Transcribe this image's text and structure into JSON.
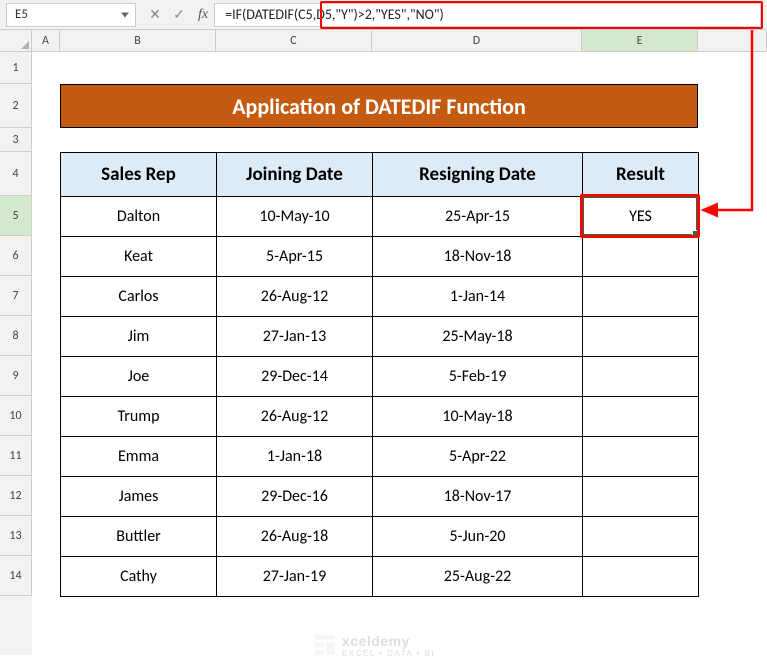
{
  "name_box": "E5",
  "formula": "=IF(DATEDIF(C5,D5,\"Y\")>2,\"YES\",\"NO\")",
  "col_headers": [
    "A",
    "B",
    "C",
    "D",
    "E"
  ],
  "row_headers": [
    "1",
    "2",
    "3",
    "4",
    "5",
    "6",
    "7",
    "8",
    "9",
    "10",
    "11",
    "12",
    "13",
    "14"
  ],
  "title": "Application of DATEDIF Function",
  "table": {
    "headers": [
      "Sales Rep",
      "Joining Date",
      "Resigning Date",
      "Result"
    ],
    "rows": [
      {
        "rep": "Dalton",
        "join": "10-May-10",
        "resign": "25-Apr-15",
        "result": "YES"
      },
      {
        "rep": "Keat",
        "join": "5-Apr-15",
        "resign": "18-Nov-18",
        "result": ""
      },
      {
        "rep": "Carlos",
        "join": "26-Aug-12",
        "resign": "1-Jan-14",
        "result": ""
      },
      {
        "rep": "Jim",
        "join": "27-Jan-13",
        "resign": "25-May-18",
        "result": ""
      },
      {
        "rep": "Joe",
        "join": "29-Dec-14",
        "resign": "5-Feb-19",
        "result": ""
      },
      {
        "rep": "Trump",
        "join": "26-Aug-12",
        "resign": "10-May-18",
        "result": ""
      },
      {
        "rep": "Emma",
        "join": "1-Jan-18",
        "resign": "5-Apr-22",
        "result": ""
      },
      {
        "rep": "James",
        "join": "29-Dec-16",
        "resign": "18-Nov-17",
        "result": ""
      },
      {
        "rep": "Buttler",
        "join": "26-Aug-18",
        "resign": "5-Jun-20",
        "result": ""
      },
      {
        "rep": "Cathy",
        "join": "27-Jan-19",
        "resign": "25-Aug-22",
        "result": ""
      }
    ]
  },
  "watermark": {
    "brand": "xceldemy",
    "tagline": "EXCEL • DATA • BI"
  }
}
